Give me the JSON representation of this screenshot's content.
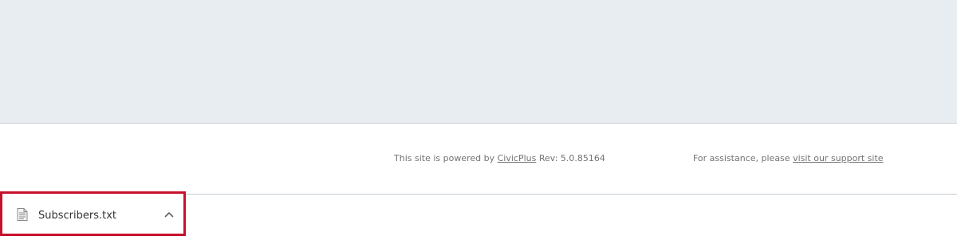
{
  "footer": {
    "powered_prefix": "This site is powered by ",
    "powered_link": "CivicPlus",
    "rev": " Rev: 5.0.85164",
    "assist_prefix": "For assistance, please ",
    "assist_link": "visit our support site"
  },
  "downloads": {
    "file_name": "Subscribers.txt",
    "file_icon": "text-file-icon",
    "toggle_icon": "chevron-up-icon",
    "highlight_color": "#c8102e"
  }
}
